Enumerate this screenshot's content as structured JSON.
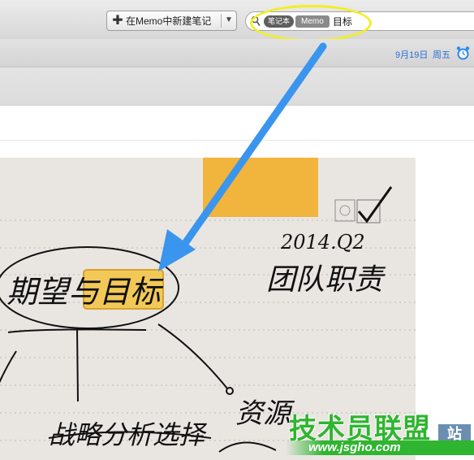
{
  "toolbar": {
    "new_note_label": "在Memo中新建笔记",
    "new_note_icon": "plus-icon",
    "dropdown_icon": "chevron-down-icon"
  },
  "search": {
    "icon": "search-icon",
    "token_notebook": "笔记本",
    "token_memo": "Memo",
    "query": "目标"
  },
  "datebar": {
    "date": "9月19日",
    "weekday": "周五",
    "alarm_icon": "alarm-clock-icon"
  },
  "note": {
    "handwriting_center": "期望与目标",
    "handwriting_date": "2014.Q2",
    "handwriting_team": "团队职责",
    "handwriting_resources": "资源",
    "handwriting_strategy": "战略分析选择"
  },
  "watermark": {
    "main": "技术员联盟",
    "site": "站",
    "url": "www.jsgho.com"
  },
  "colors": {
    "highlight": "#f3ee24",
    "arrow": "#3a95ee",
    "link_blue": "#2a6fd6",
    "watermark_green": "#2fb52f"
  }
}
